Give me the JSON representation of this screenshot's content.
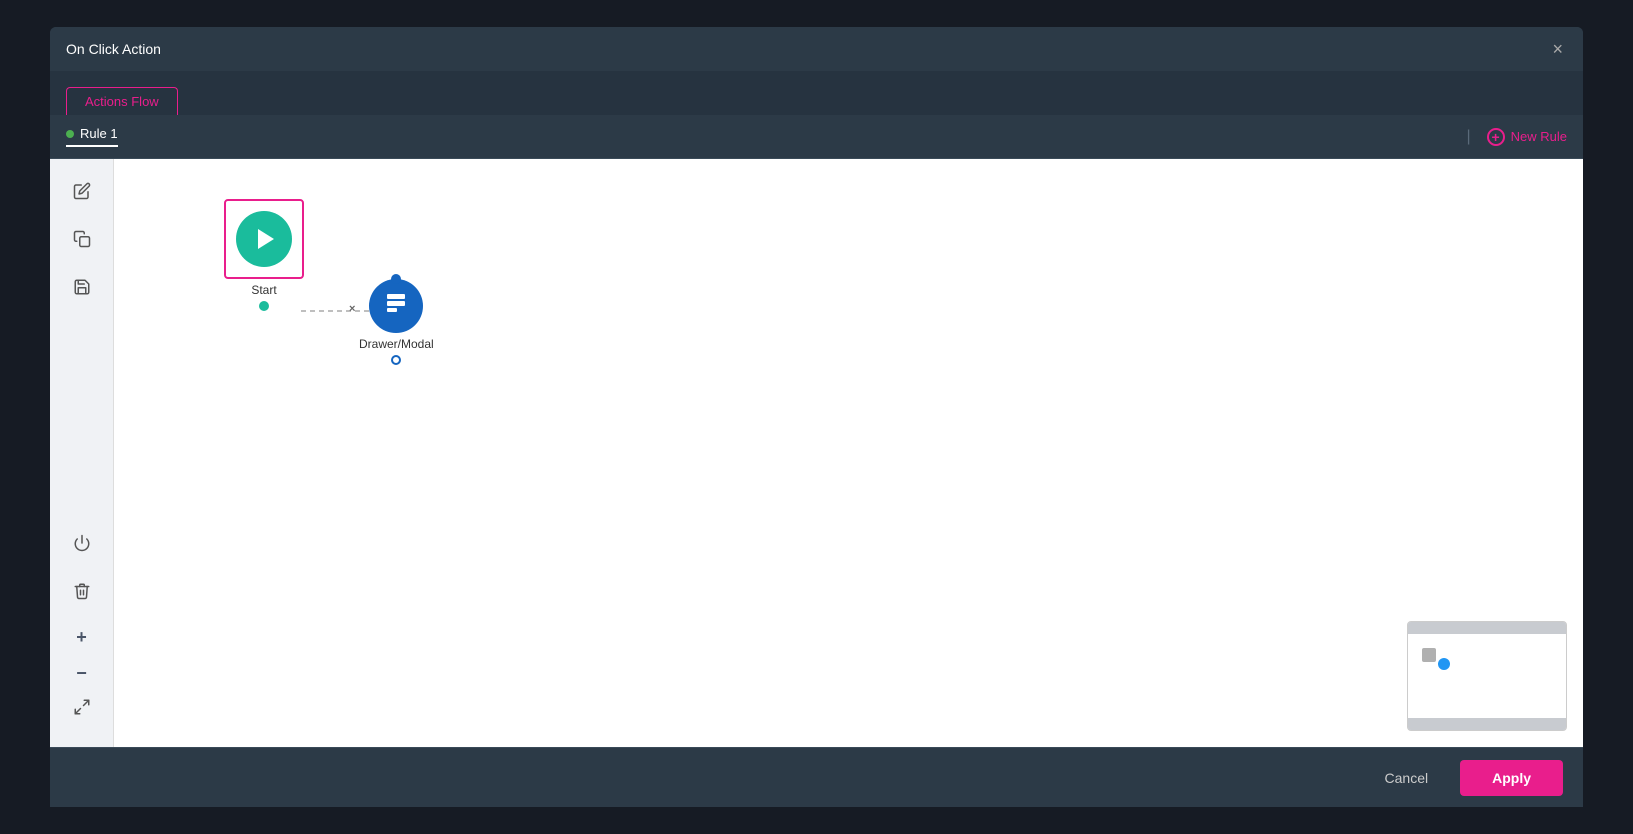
{
  "modal": {
    "title": "On Click Action",
    "close_label": "×"
  },
  "tabs": {
    "actions_flow_label": "Actions Flow"
  },
  "rule_bar": {
    "rule_label": "Rule 1",
    "new_rule_label": "New Rule",
    "rule_dot_color": "#4caf50"
  },
  "toolbar": {
    "edit_icon": "✏",
    "copy_icon": "⧉",
    "save_icon": "💾",
    "power_icon": "⏻",
    "delete_icon": "🗑",
    "zoom_in": "+",
    "zoom_out": "−",
    "fit_icon": "⛶"
  },
  "nodes": {
    "start": {
      "label": "Start"
    },
    "drawer_modal": {
      "label": "Drawer/Modal"
    }
  },
  "footer": {
    "cancel_label": "Cancel",
    "apply_label": "Apply"
  }
}
